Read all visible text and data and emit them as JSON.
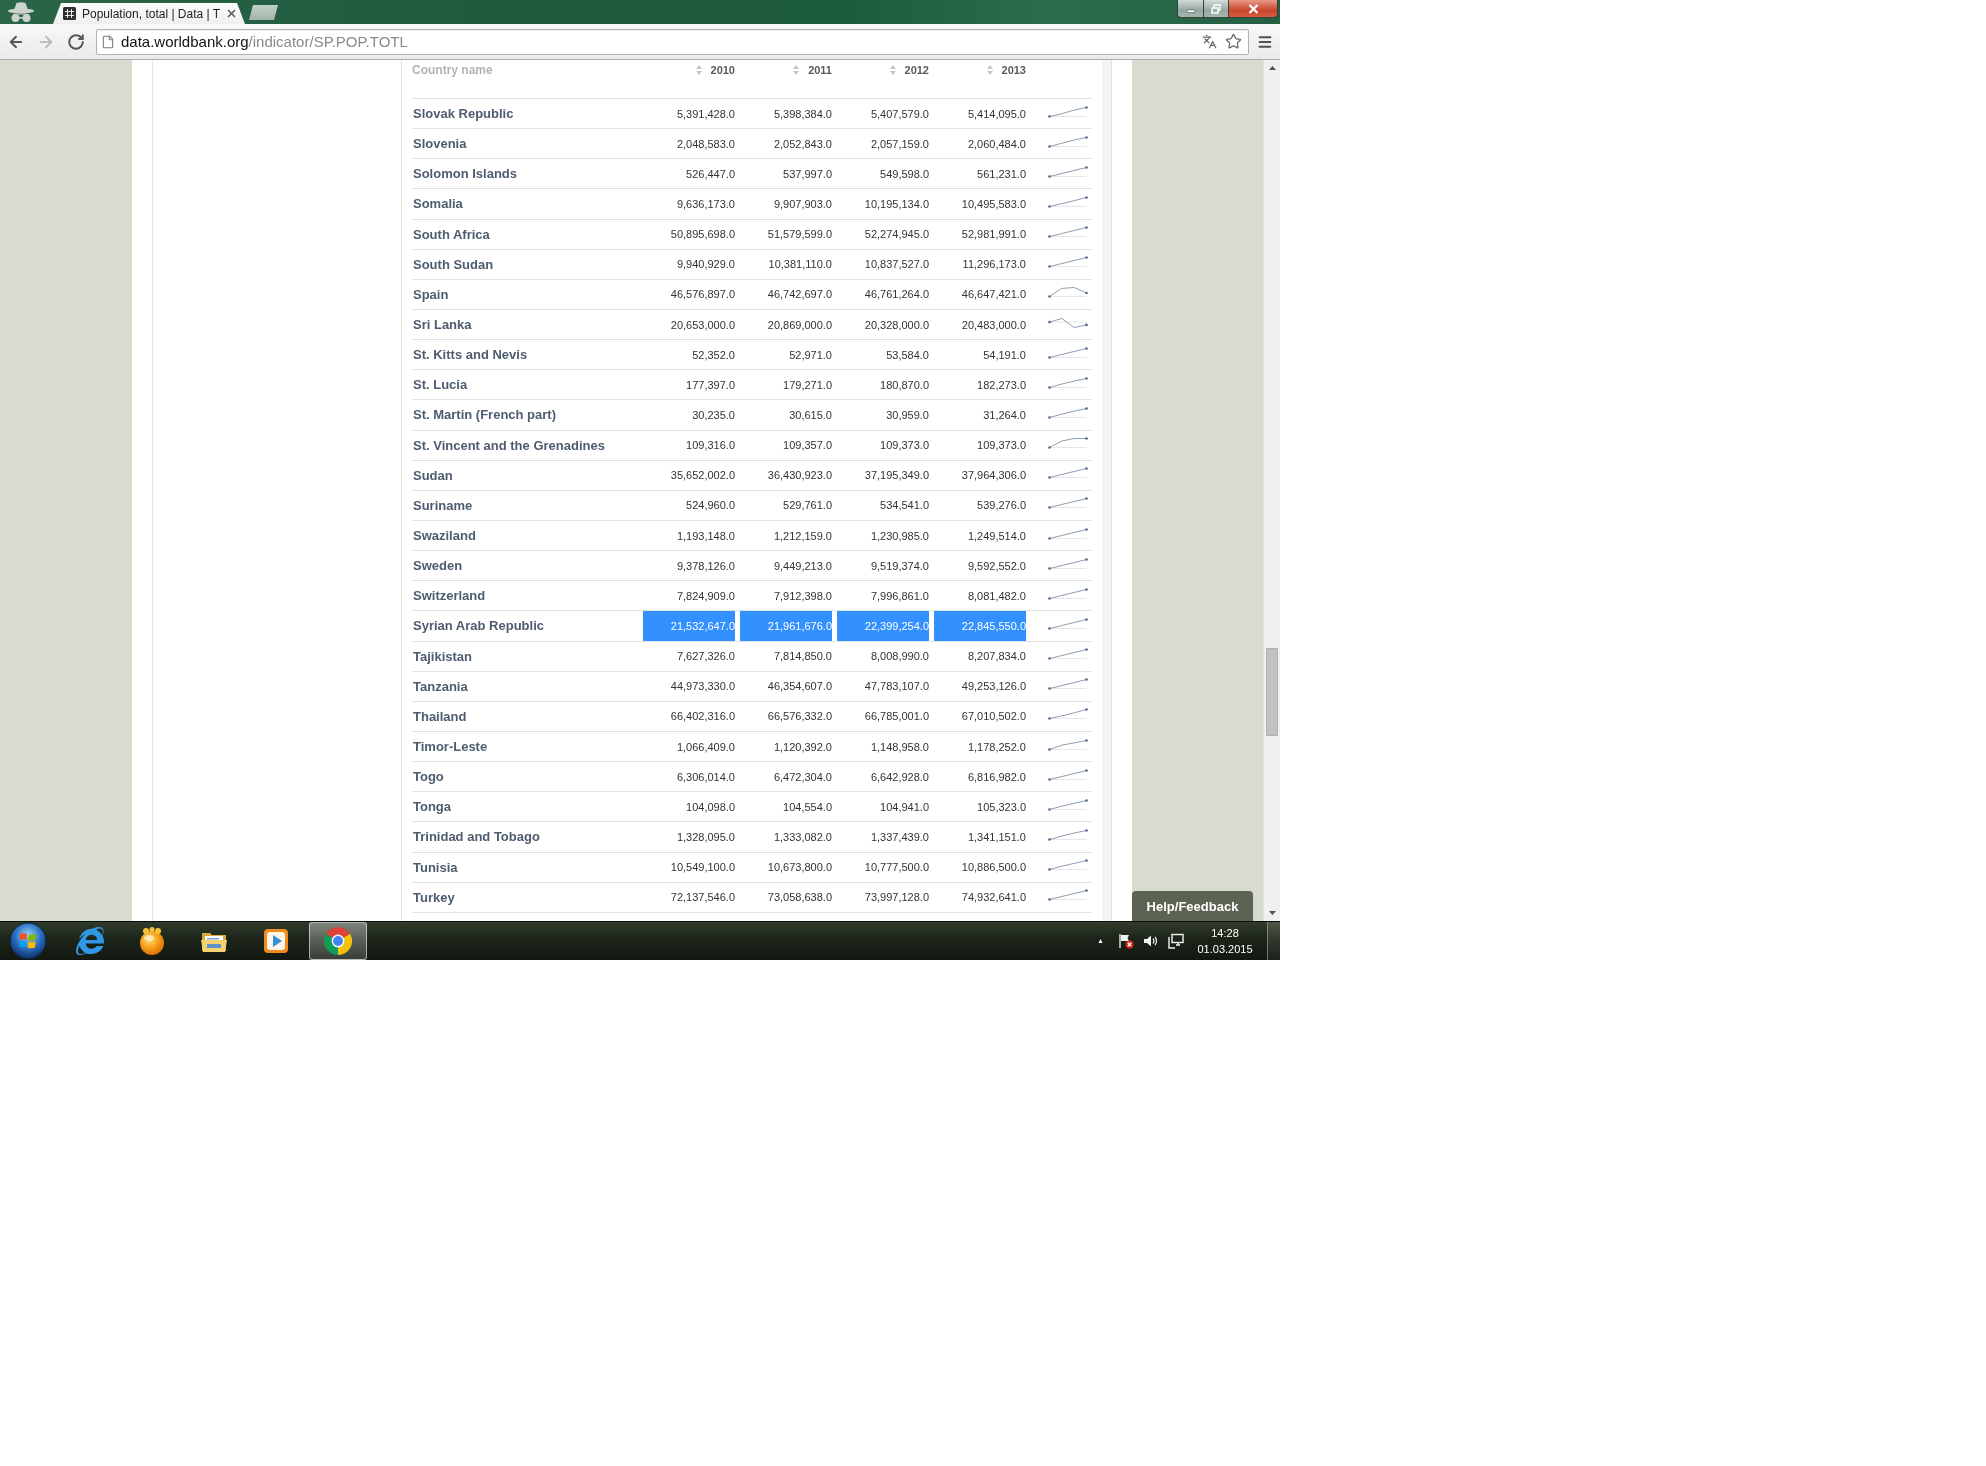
{
  "browser": {
    "tabs": [
      {
        "title": "Population, total | Data | T",
        "selected": true
      }
    ],
    "navigation": [
      {
        "kind": "back",
        "disabled": false
      },
      {
        "kind": "forward",
        "disabled": true
      },
      {
        "kind": "reload",
        "disabled": false
      }
    ],
    "address": {
      "host": "data.worldbank.org",
      "path": "/indicator/SP.POP.TOTL"
    }
  },
  "table": {
    "columns": [
      "Country name",
      "2010",
      "2011",
      "2012",
      "2013"
    ],
    "rows": [
      {
        "country": "Slovak Republic",
        "values": [
          "5,391,428.0",
          "5,398,384.0",
          "5,407,579.0",
          "5,414,095.0"
        ],
        "selected": false
      },
      {
        "country": "Slovenia",
        "values": [
          "2,048,583.0",
          "2,052,843.0",
          "2,057,159.0",
          "2,060,484.0"
        ],
        "selected": false
      },
      {
        "country": "Solomon Islands",
        "values": [
          "526,447.0",
          "537,997.0",
          "549,598.0",
          "561,231.0"
        ],
        "selected": false
      },
      {
        "country": "Somalia",
        "values": [
          "9,636,173.0",
          "9,907,903.0",
          "10,195,134.0",
          "10,495,583.0"
        ],
        "selected": false
      },
      {
        "country": "South Africa",
        "values": [
          "50,895,698.0",
          "51,579,599.0",
          "52,274,945.0",
          "52,981,991.0"
        ],
        "selected": false
      },
      {
        "country": "South Sudan",
        "values": [
          "9,940,929.0",
          "10,381,110.0",
          "10,837,527.0",
          "11,296,173.0"
        ],
        "selected": false
      },
      {
        "country": "Spain",
        "values": [
          "46,576,897.0",
          "46,742,697.0",
          "46,761,264.0",
          "46,647,421.0"
        ],
        "selected": false
      },
      {
        "country": "Sri Lanka",
        "values": [
          "20,653,000.0",
          "20,869,000.0",
          "20,328,000.0",
          "20,483,000.0"
        ],
        "selected": false
      },
      {
        "country": "St. Kitts and Nevis",
        "values": [
          "52,352.0",
          "52,971.0",
          "53,584.0",
          "54,191.0"
        ],
        "selected": false
      },
      {
        "country": "St. Lucia",
        "values": [
          "177,397.0",
          "179,271.0",
          "180,870.0",
          "182,273.0"
        ],
        "selected": false
      },
      {
        "country": "St. Martin (French part)",
        "values": [
          "30,235.0",
          "30,615.0",
          "30,959.0",
          "31,264.0"
        ],
        "selected": false
      },
      {
        "country": "St. Vincent and the Grenadines",
        "values": [
          "109,316.0",
          "109,357.0",
          "109,373.0",
          "109,373.0"
        ],
        "selected": false
      },
      {
        "country": "Sudan",
        "values": [
          "35,652,002.0",
          "36,430,923.0",
          "37,195,349.0",
          "37,964,306.0"
        ],
        "selected": false
      },
      {
        "country": "Suriname",
        "values": [
          "524,960.0",
          "529,761.0",
          "534,541.0",
          "539,276.0"
        ],
        "selected": false
      },
      {
        "country": "Swaziland",
        "values": [
          "1,193,148.0",
          "1,212,159.0",
          "1,230,985.0",
          "1,249,514.0"
        ],
        "selected": false
      },
      {
        "country": "Sweden",
        "values": [
          "9,378,126.0",
          "9,449,213.0",
          "9,519,374.0",
          "9,592,552.0"
        ],
        "selected": false
      },
      {
        "country": "Switzerland",
        "values": [
          "7,824,909.0",
          "7,912,398.0",
          "7,996,861.0",
          "8,081,482.0"
        ],
        "selected": false
      },
      {
        "country": "Syrian Arab Republic",
        "values": [
          "21,532,647.0",
          "21,961,676.0",
          "22,399,254.0",
          "22,845,550.0"
        ],
        "selected": true
      },
      {
        "country": "Tajikistan",
        "values": [
          "7,627,326.0",
          "7,814,850.0",
          "8,008,990.0",
          "8,207,834.0"
        ],
        "selected": false
      },
      {
        "country": "Tanzania",
        "values": [
          "44,973,330.0",
          "46,354,607.0",
          "47,783,107.0",
          "49,253,126.0"
        ],
        "selected": false
      },
      {
        "country": "Thailand",
        "values": [
          "66,402,316.0",
          "66,576,332.0",
          "66,785,001.0",
          "67,010,502.0"
        ],
        "selected": false
      },
      {
        "country": "Timor-Leste",
        "values": [
          "1,066,409.0",
          "1,120,392.0",
          "1,148,958.0",
          "1,178,252.0"
        ],
        "selected": false
      },
      {
        "country": "Togo",
        "values": [
          "6,306,014.0",
          "6,472,304.0",
          "6,642,928.0",
          "6,816,982.0"
        ],
        "selected": false
      },
      {
        "country": "Tonga",
        "values": [
          "104,098.0",
          "104,554.0",
          "104,941.0",
          "105,323.0"
        ],
        "selected": false
      },
      {
        "country": "Trinidad and Tobago",
        "values": [
          "1,328,095.0",
          "1,333,082.0",
          "1,337,439.0",
          "1,341,151.0"
        ],
        "selected": false
      },
      {
        "country": "Tunisia",
        "values": [
          "10,549,100.0",
          "10,673,800.0",
          "10,777,500.0",
          "10,886,500.0"
        ],
        "selected": false
      },
      {
        "country": "Turkey",
        "values": [
          "72,137,546.0",
          "73,058,638.0",
          "73,997,128.0",
          "74,932,641.0"
        ],
        "selected": false
      }
    ]
  },
  "help_button": "Help/Feedback",
  "taskbar": {
    "apps": [
      {
        "kind": "ie",
        "active": false
      },
      {
        "kind": "ball",
        "active": false
      },
      {
        "kind": "folder",
        "active": false
      },
      {
        "kind": "media",
        "active": false
      },
      {
        "kind": "chrome",
        "active": true
      }
    ],
    "clock": {
      "time": "14:28",
      "date": "01.03.2015"
    }
  }
}
